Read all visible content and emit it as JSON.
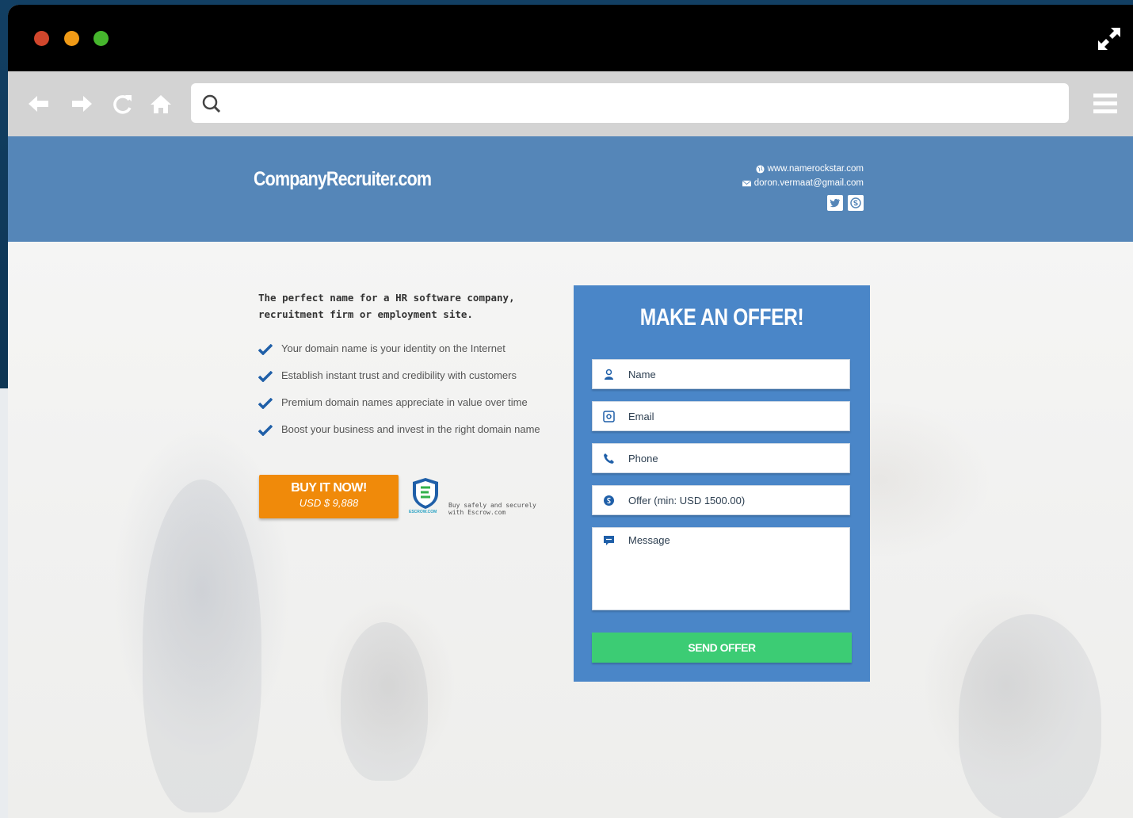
{
  "browser": {
    "address_placeholder": ""
  },
  "header": {
    "brand": "CompanyRecruiter.com",
    "website": "www.namerockstar.com",
    "email": "doron.vermaat@gmail.com"
  },
  "hero": {
    "tagline": "The perfect name for a HR software company, recruitment firm or employment site.",
    "features": [
      "Your domain name is your identity on the Internet",
      "Establish instant trust and credibility with customers",
      "Premium domain names appreciate in value over time",
      "Boost your business and invest in the right domain name"
    ],
    "buy_button": {
      "title": "BUY IT NOW!",
      "price": "USD $ 9,888"
    },
    "escrow": {
      "brand": "ESCROW.COM",
      "text_line1": "Buy safely and securely",
      "text_line2": "with Escrow.com"
    }
  },
  "offer_form": {
    "title": "MAKE AN OFFER!",
    "name_placeholder": "Name",
    "email_placeholder": "Email",
    "phone_placeholder": "Phone",
    "offer_placeholder": "Offer (min: USD 1500.00)",
    "message_placeholder": "Message",
    "submit_label": "SEND OFFER"
  },
  "colors": {
    "header_bg": "#5586b8",
    "panel_bg": "#4a86c8",
    "buy_button": "#f08a0a",
    "send_button": "#3ccc74"
  }
}
